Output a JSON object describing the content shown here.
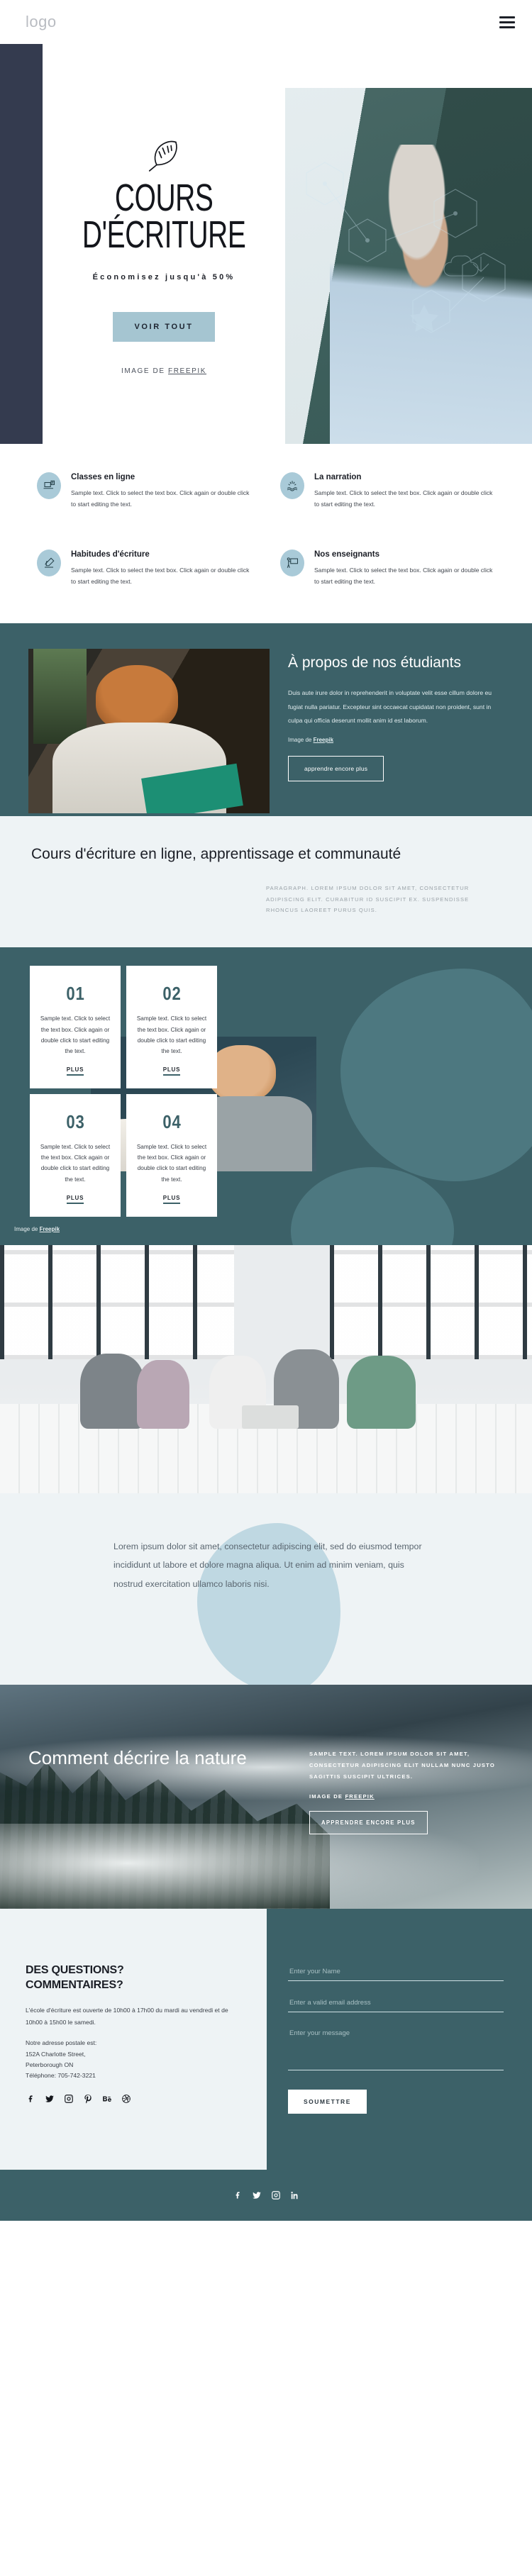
{
  "header": {
    "logo": "logo",
    "menu_icon": "hamburger-icon"
  },
  "hero": {
    "icon": "feather-icon",
    "title_line1": "COURS",
    "title_line2": "D'ÉCRITURE",
    "subtitle": "Économisez jusqu'à 50%",
    "button": "VOIR TOUT",
    "credit_prefix": "IMAGE DE ",
    "credit_link": "FREEPIK",
    "photo_alt": "senior-man-with-smartphone-photo"
  },
  "features": [
    {
      "icon": "laptop-presentation-icon",
      "title": "Classes en ligne",
      "text": "Sample text. Click to select the text box. Click again or double click to start editing the text."
    },
    {
      "icon": "sparkle-waves-icon",
      "title": "La narration",
      "text": "Sample text. Click to select the text box. Click again or double click to start editing the text."
    },
    {
      "icon": "hand-writing-icon",
      "title": "Habitudes d'écriture",
      "text": "Sample text. Click to select the text box. Click again or double click to start editing the text."
    },
    {
      "icon": "teacher-board-icon",
      "title": "Nos enseignants",
      "text": "Sample text. Click to select the text box. Click again or double click to start editing the text."
    }
  ],
  "about": {
    "photo_alt": "man-reading-green-book-photo",
    "title": "À propos de nos étudiants",
    "text": "Duis aute irure dolor in reprehenderit in voluptate velit esse cillum dolore eu fugiat nulla pariatur. Excepteur sint occaecat cupidatat non proident, sunt in culpa qui officia deserunt mollit anim id est laborum.",
    "credit_prefix": "Image de ",
    "credit_link": "Freepik",
    "button": "apprendre encore plus"
  },
  "headline": {
    "title": "Cours d'écriture en ligne, apprentissage et communauté",
    "paragraph": "PARAGRAPH. LOREM IPSUM DOLOR SIT AMET, CONSECTETUR ADIPISCING ELIT. CURABITUR ID SUSCIPIT EX. SUSPENDISSE RHONCUS LAOREET PURUS QUIS."
  },
  "numbers": {
    "photo_alt": "man-with-glasses-writing-at-laptop-photo",
    "credit_prefix": "Image de ",
    "credit_link": "Freepik",
    "cards": [
      {
        "number": "01",
        "text": "Sample text. Click to select the text box. Click again or double click to start editing the text.",
        "link": "PLUS"
      },
      {
        "number": "02",
        "text": "Sample text. Click to select the text box. Click again or double click to start editing the text.",
        "link": "PLUS"
      },
      {
        "number": "03",
        "text": "Sample text. Click to select the text box. Click again or double click to start editing the text.",
        "link": "PLUS"
      },
      {
        "number": "04",
        "text": "Sample text. Click to select the text box. Click again or double click to start editing the text.",
        "link": "PLUS"
      }
    ]
  },
  "group_photo": {
    "alt": "five-people-sitting-on-floor-around-laptop-photo"
  },
  "lorem": {
    "text": "Lorem ipsum dolor sit amet, consectetur adipiscing elit, sed do eiusmod tempor incididunt ut labore et dolore magna aliqua. Ut enim ad minim veniam, quis nostrud exercitation ullamco laboris nisi."
  },
  "nature": {
    "photo_alt": "foggy-forest-valley-photo",
    "title": "Comment décrire la nature",
    "text": "SAMPLE TEXT. LOREM IPSUM DOLOR SIT AMET, CONSECTETUR ADIPISCING ELIT NULLAM NUNC JUSTO SAGITTIS SUSCIPIT ULTRICES.",
    "credit_prefix": "IMAGE DE ",
    "credit_link": "FREEPIK",
    "button": "APPRENDRE ENCORE PLUS"
  },
  "contact": {
    "heading_line1": "DES QUESTIONS?",
    "heading_line2": "COMMENTAIRES?",
    "hours": "L'école d'écriture est ouverte de 10h00 à 17h00 du mardi au vendredi et de 10h00 à 15h00 le samedi.",
    "address_label": "Notre adresse postale est:",
    "address_line1": "152A Charlotte Street,",
    "address_line2": "Peterborough ON",
    "phone": "Téléphone: 705-742-3221",
    "socials": [
      "facebook-icon",
      "twitter-icon",
      "instagram-icon",
      "pinterest-icon",
      "behance-icon",
      "dribbble-icon"
    ],
    "form": {
      "name_placeholder": "Enter your Name",
      "email_placeholder": "Enter a valid email address",
      "message_placeholder": "Enter your message",
      "name_value": "",
      "email_value": "",
      "message_value": "",
      "submit": "SOUMETTRE"
    }
  },
  "footer": {
    "socials": [
      "facebook-icon",
      "twitter-icon",
      "instagram-icon",
      "linkedin-icon"
    ]
  },
  "colors": {
    "teal": "#3c6168",
    "teal_light": "#4d7880",
    "navy": "#343b4f",
    "light_blue": "#a5c5d1",
    "pale_bg": "#eef3f5",
    "blob_blue": "#bfd8e2"
  }
}
